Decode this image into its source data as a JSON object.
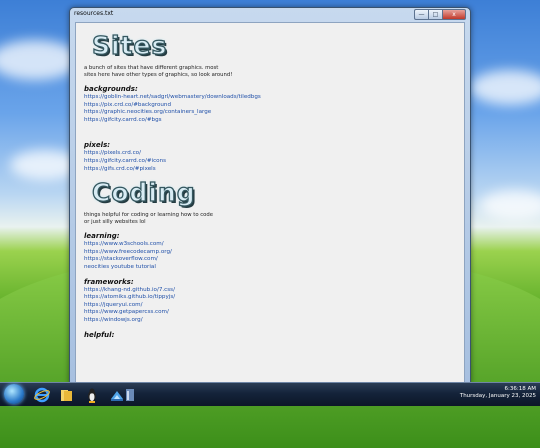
{
  "window": {
    "title": "resources.txt",
    "buttons": {
      "minimize": "—",
      "maximize": "□",
      "close": "x"
    }
  },
  "sections": [
    {
      "banner": "Sites",
      "description_lines": [
        "a bunch of sites that have different graphics. most",
        "sites here have other types of graphics, so look around!"
      ],
      "groups": [
        {
          "heading": "backgrounds:",
          "links": [
            "https://goblin-heart.net/sadgrl/webmastery/downloads/tiledbgs",
            "https://pix.crd.co/#background",
            "https://graphic.neocities.org/containers_large",
            "https://gifcity.carrd.co/#bgs"
          ]
        },
        {
          "heading": "pixels:",
          "links": [
            "https://pixels.crd.co/",
            "https://gifcity.carrd.co/#icons",
            "https://gifs.crd.co/#pixels"
          ]
        }
      ]
    },
    {
      "banner": "Coding",
      "description_lines": [
        "things helpful for coding or learning how to code",
        "or just silly websites lol"
      ],
      "groups": [
        {
          "heading": "learning:",
          "links": [
            "https://www.w3schools.com/",
            "https://www.freecodecamp.org/",
            "https://stackoverflow.com/",
            "neocities youtube tutorial"
          ]
        },
        {
          "heading": "frameworks:",
          "links": [
            "https://khang-nd.github.io/7.css/",
            "https://atomiks.github.io/tippyjs/",
            "https://jqueryui.com/",
            "https://www.getpapercss.com/",
            "https://windowjs.org/"
          ]
        },
        {
          "heading": "helpful:",
          "links": []
        }
      ]
    }
  ],
  "taskbar": {
    "pinned_icons": [
      "internet-explorer-icon",
      "folder-icon",
      "tux-icon",
      "paint-icon",
      "file-icon"
    ],
    "clock": {
      "time": "6:36:18 AM",
      "date": "Thursday, January 23, 2025"
    }
  }
}
